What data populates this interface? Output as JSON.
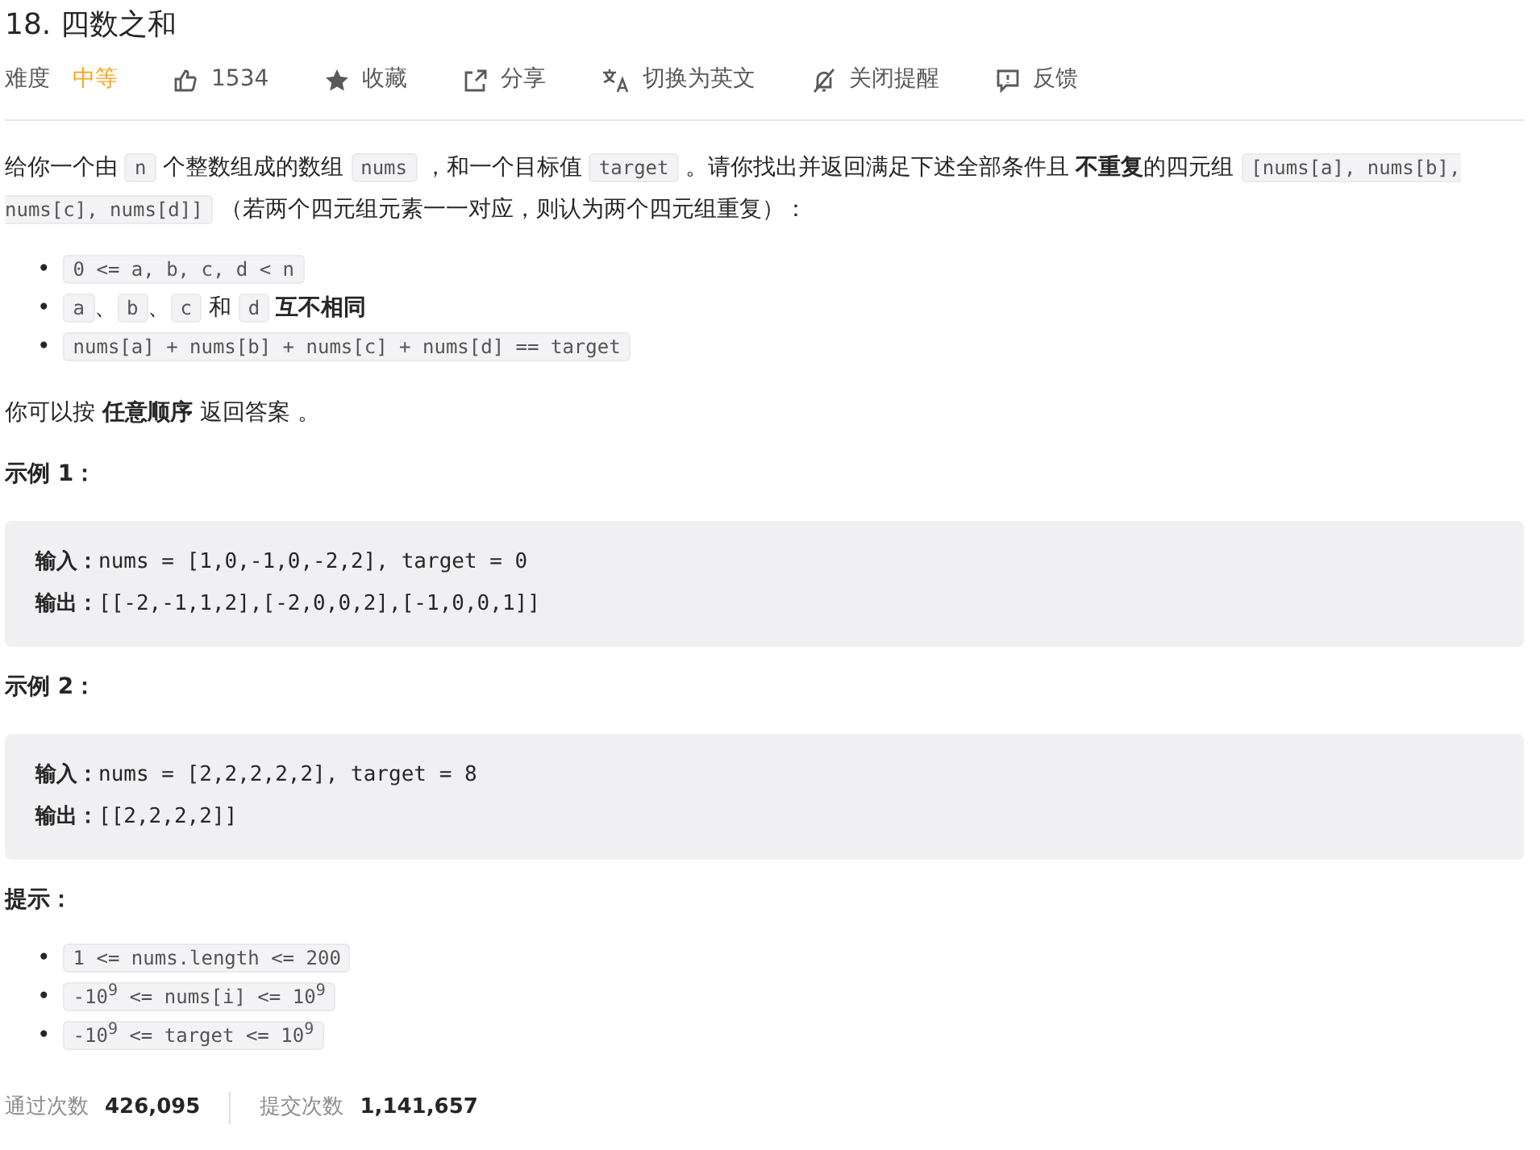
{
  "title": "18. 四数之和",
  "meta": {
    "difficulty_label": "难度",
    "difficulty": "中等",
    "actions": [
      {
        "kind": "like",
        "label": "1534"
      },
      {
        "kind": "star",
        "label": "收藏"
      },
      {
        "kind": "share",
        "label": "分享"
      },
      {
        "kind": "translate",
        "label": "切换为英文"
      },
      {
        "kind": "bell-off",
        "label": "关闭提醒"
      },
      {
        "kind": "feedback",
        "label": "反馈"
      }
    ]
  },
  "description": [
    [
      {
        "kind": "text",
        "text": "给你一个由 "
      },
      {
        "kind": "code",
        "text": "n"
      },
      {
        "kind": "text",
        "text": " 个整数组成的数组 "
      },
      {
        "kind": "code",
        "text": "nums"
      },
      {
        "kind": "text",
        "text": " ，和一个目标值 "
      },
      {
        "kind": "code",
        "text": "target"
      },
      {
        "kind": "text",
        "text": " 。请你找出并返回满足下述全部条件且"
      },
      {
        "kind": "bold",
        "text": "不重复"
      },
      {
        "kind": "text",
        "text": "的四元组 "
      },
      {
        "kind": "code",
        "text": "[nums[a], nums[b], nums[c], nums[d]]"
      },
      {
        "kind": "text",
        "text": " （若两个四元组元素一一对应，则认为两个四元组重复）："
      }
    ]
  ],
  "conditions": [
    [
      {
        "kind": "code",
        "text": "0 <= a, b, c, d < n"
      }
    ],
    [
      {
        "kind": "code",
        "text": "a"
      },
      {
        "kind": "text",
        "text": "、"
      },
      {
        "kind": "code",
        "text": "b"
      },
      {
        "kind": "text",
        "text": "、"
      },
      {
        "kind": "code",
        "text": "c"
      },
      {
        "kind": "text",
        "text": " 和 "
      },
      {
        "kind": "code",
        "text": "d"
      },
      {
        "kind": "bold",
        "text": "互不相同"
      }
    ],
    [
      {
        "kind": "code",
        "text": "nums[a] + nums[b] + nums[c] + nums[d] == target"
      }
    ]
  ],
  "bullet": "•",
  "answer_note": [
    {
      "kind": "text",
      "text": "你可以按 "
    },
    {
      "kind": "bold",
      "text": "任意顺序"
    },
    {
      "kind": "text",
      "text": " 返回答案 。"
    }
  ],
  "examples": [
    {
      "title": "示例 1：",
      "lines": [
        {
          "label": "输入：",
          "value": "nums = [1,0,-1,0,-2,2], target = 0"
        },
        {
          "label": "输出：",
          "value": "[[-2,-1,1,2],[-2,0,0,2],[-1,0,0,1]]"
        }
      ]
    },
    {
      "title": "示例 2：",
      "lines": [
        {
          "label": "输入：",
          "value": "nums = [2,2,2,2,2], target = 8"
        },
        {
          "label": "输出：",
          "value": "[[2,2,2,2]]"
        }
      ]
    }
  ],
  "hints_title": "提示：",
  "hints": [
    "1 <= nums.length <= 200",
    "-10$^{9}$ <= nums[i] <= 10$^{9}$",
    "-10$^{9}$ <= target <= 10$^{9}$"
  ],
  "stats": [
    {
      "label": "通过次数",
      "value": "426,095"
    },
    {
      "label": "提交次数",
      "value": "1,141,657"
    }
  ]
}
